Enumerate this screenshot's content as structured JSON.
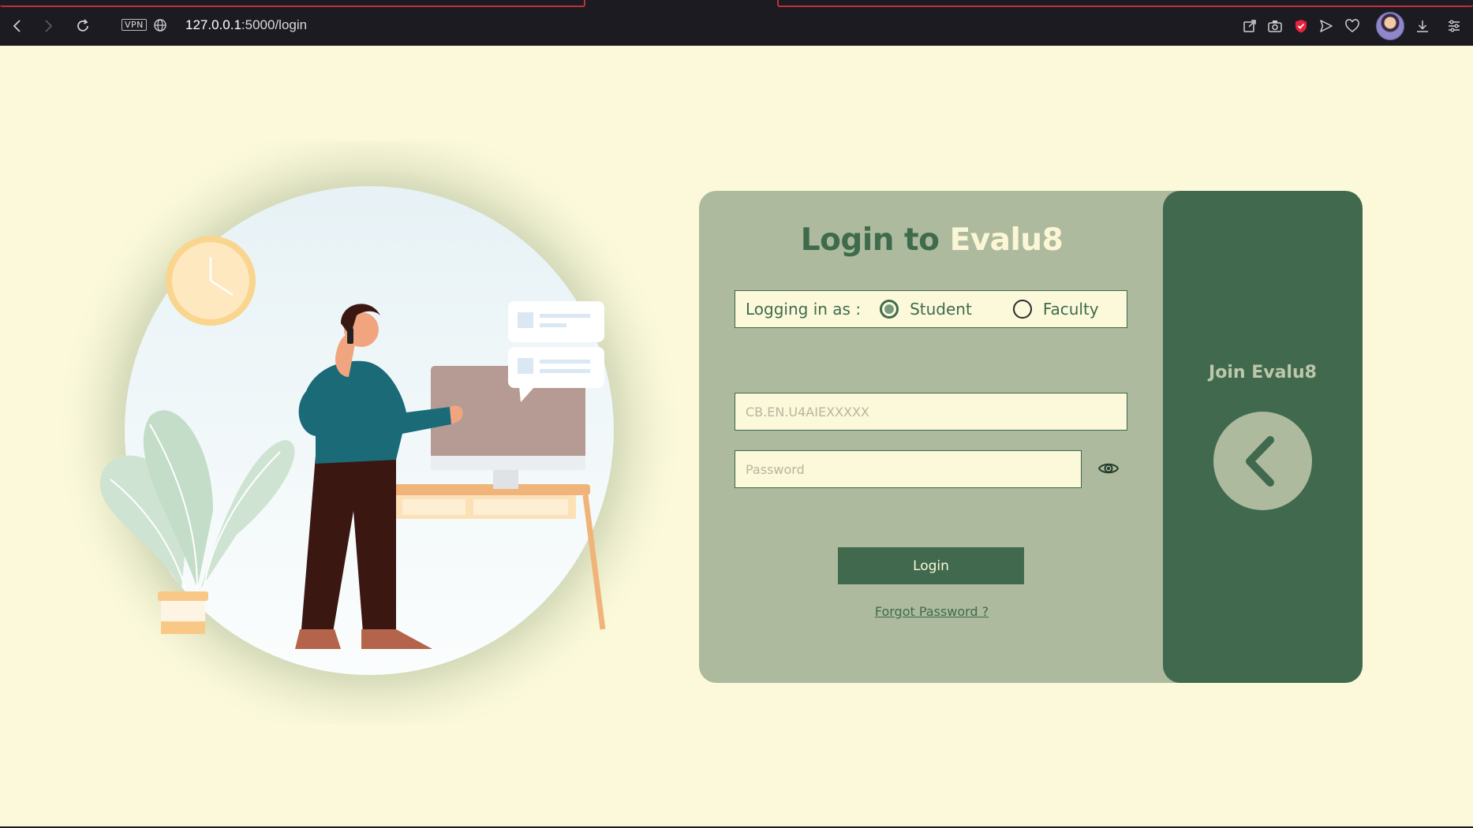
{
  "browser": {
    "vpn_label": "VPN",
    "url_host": "127.0.0.1",
    "url_rest": ":5000/login",
    "icons": [
      "back-icon",
      "forward-icon",
      "reload-icon",
      "globe-icon",
      "share-icon",
      "camera-icon",
      "shield-icon",
      "send-icon",
      "heart-icon",
      "download-icon",
      "menu-icon"
    ]
  },
  "login": {
    "title_prefix": "Login to",
    "title_brand": "Evalu8",
    "role_label": "Logging in as :",
    "roles": [
      {
        "label": "Student",
        "selected": true
      },
      {
        "label": "Faculty",
        "selected": false
      }
    ],
    "username_placeholder": "CB.EN.U4AIEXXXXX",
    "password_placeholder": "Password",
    "login_button": "Login",
    "forgot_link": "Forgot Password ?"
  },
  "side": {
    "title": "Join Evalu8"
  },
  "colors": {
    "page_bg": "#fbf9da",
    "card_bg": "#adba9d",
    "accent_dark_green": "#41694d",
    "brand_cream": "#fbf7d6"
  }
}
